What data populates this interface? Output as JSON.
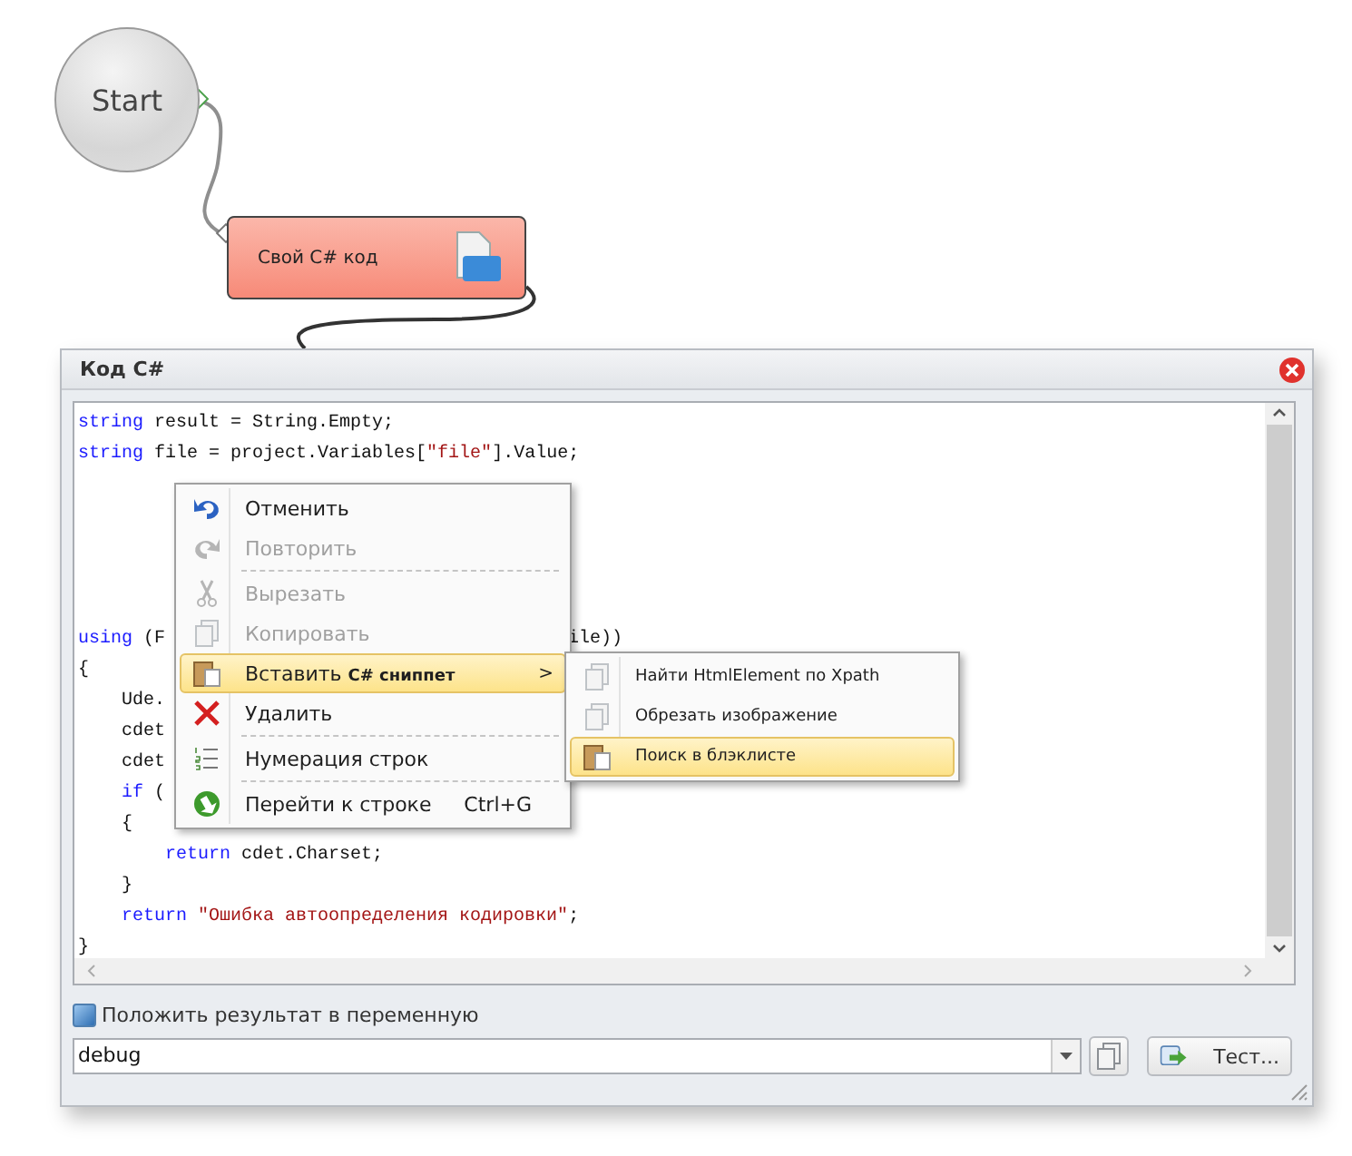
{
  "canvas": {
    "start_node": {
      "label": "Start"
    },
    "code_node": {
      "label": "Свой C# код"
    }
  },
  "dialog": {
    "title": "Код C#",
    "code_lines": [
      {
        "kind": "code",
        "parts": [
          {
            "tokens": [
              {
                "kind": "keyword",
                "text": "string"
              },
              {
                "kind": "text",
                "text": " result = String.Empty;"
              }
            ]
          }
        ]
      },
      {
        "kind": "code",
        "parts": [
          {
            "tokens": [
              {
                "kind": "keyword",
                "text": "string"
              },
              {
                "kind": "text",
                "text": " file = project.Variables["
              },
              {
                "kind": "string",
                "text": "\"file\""
              },
              {
                "kind": "text",
                "text": "].Value;"
              }
            ]
          }
        ]
      },
      {
        "kind": "blank"
      },
      {
        "kind": "blank"
      },
      {
        "kind": "blank"
      },
      {
        "kind": "blank"
      },
      {
        "kind": "blank"
      },
      {
        "kind": "code",
        "parts": [
          {
            "tokens": [
              {
                "kind": "keyword",
                "text": "using"
              },
              {
                "kind": "text",
                "text": " (F"
              }
            ]
          },
          {
            "tokens": [
              {
                "kind": "text",
                "text": "ile))"
              }
            ]
          }
        ]
      },
      {
        "kind": "code",
        "parts": [
          {
            "tokens": [
              {
                "kind": "text",
                "text": "{"
              }
            ]
          }
        ]
      },
      {
        "kind": "code",
        "parts": [
          {
            "tokens": [
              {
                "kind": "text",
                "text": "    Ude."
              }
            ]
          }
        ]
      },
      {
        "kind": "code",
        "parts": [
          {
            "tokens": [
              {
                "kind": "text",
                "text": "    cdet"
              }
            ]
          }
        ]
      },
      {
        "kind": "code",
        "parts": [
          {
            "tokens": [
              {
                "kind": "text",
                "text": "    cdet"
              }
            ]
          }
        ]
      },
      {
        "kind": "code",
        "parts": [
          {
            "tokens": [
              {
                "kind": "keyword",
                "text": "    if"
              },
              {
                "kind": "text",
                "text": " ("
              }
            ]
          }
        ]
      },
      {
        "kind": "code",
        "parts": [
          {
            "tokens": [
              {
                "kind": "text",
                "text": "    {"
              }
            ]
          }
        ]
      },
      {
        "kind": "code",
        "parts": [
          {
            "tokens": [
              {
                "kind": "keyword",
                "text": "        return"
              },
              {
                "kind": "text",
                "text": " cdet.Charset;"
              }
            ]
          }
        ]
      },
      {
        "kind": "code",
        "parts": [
          {
            "tokens": [
              {
                "kind": "text",
                "text": "    }"
              }
            ]
          }
        ]
      },
      {
        "kind": "code",
        "parts": [
          {
            "tokens": [
              {
                "kind": "keyword",
                "text": "    return"
              },
              {
                "kind": "string",
                "text": " \"Ошибка автоопределения кодировки\""
              },
              {
                "kind": "text",
                "text": ";"
              }
            ]
          }
        ]
      },
      {
        "kind": "code",
        "parts": [
          {
            "tokens": [
              {
                "kind": "text",
                "text": "}"
              }
            ]
          }
        ]
      }
    ],
    "context_menu": {
      "items": [
        {
          "kind": "command",
          "label": "Отменить",
          "disabled": false,
          "selected": false
        },
        {
          "kind": "command",
          "label": "Повторить",
          "disabled": true,
          "selected": false
        },
        {
          "kind": "separator"
        },
        {
          "kind": "command",
          "label": "Вырезать",
          "disabled": true,
          "selected": false
        },
        {
          "kind": "command",
          "label": "Копировать",
          "disabled": true,
          "selected": false
        },
        {
          "kind": "command",
          "label": "Вставить **C# сниппет**",
          "disabled": false,
          "selected": true,
          "submenu_arrow": ">"
        },
        {
          "kind": "command",
          "label": "Удалить",
          "disabled": false,
          "selected": false
        },
        {
          "kind": "separator"
        },
        {
          "kind": "command",
          "label": "Нумерация строк",
          "disabled": false,
          "selected": false
        },
        {
          "kind": "separator"
        },
        {
          "kind": "command",
          "label": "Перейти к строке",
          "shortcut": "Ctrl+G",
          "disabled": false,
          "selected": false
        }
      ]
    },
    "submenu": {
      "items": [
        {
          "label": "Найти HtmlElement по Xpath",
          "selected": false
        },
        {
          "label": "Обрезать изображение",
          "selected": false
        },
        {
          "label": "Поиск в блэклисте",
          "selected": true
        }
      ]
    },
    "result_checkbox": {
      "label": "Положить результат в переменную",
      "checked": true
    },
    "variable_combo": {
      "value": "debug"
    },
    "test_button": {
      "label": "Тест..."
    }
  }
}
